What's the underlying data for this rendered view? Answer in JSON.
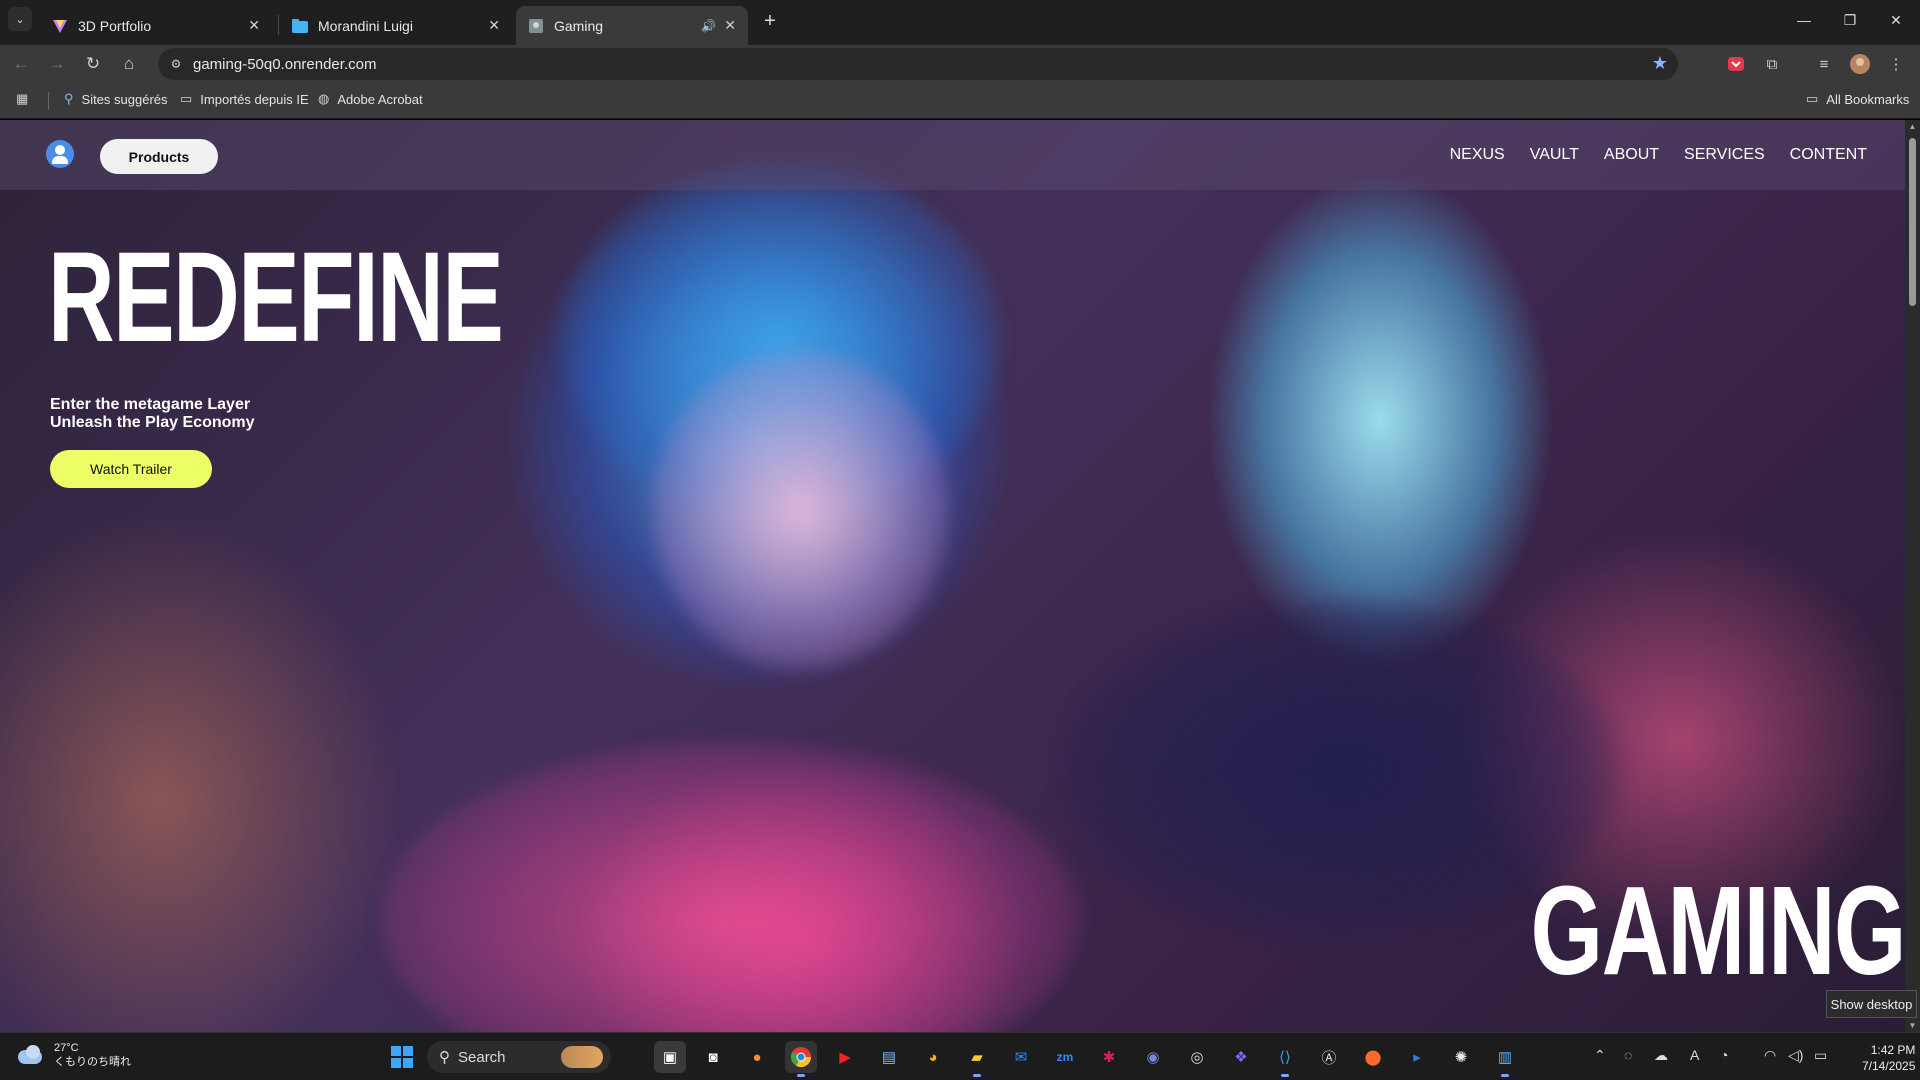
{
  "browser": {
    "tabs": [
      {
        "title": "3D Portfolio",
        "active": false
      },
      {
        "title": "Morandini Luigi",
        "active": false
      },
      {
        "title": "Gaming",
        "active": true
      }
    ],
    "url": "gaming-50q0.onrender.com",
    "bookmarks": [
      "Sites suggérés",
      "Importés depuis IE",
      "Adobe Acrobat"
    ],
    "all_bookmarks": "All Bookmarks"
  },
  "site": {
    "products_label": "Products",
    "nav": [
      "NEXUS",
      "VAULT",
      "ABOUT",
      "SERVICES",
      "CONTENT"
    ],
    "hero_title": "REDEFINE",
    "subtitle_line1": "Enter the metagame Layer",
    "subtitle_line2": "Unleash the Play Economy",
    "cta_label": "Watch Trailer",
    "hero_bottom": "GAMING"
  },
  "tooltip": "Show desktop",
  "taskbar": {
    "weather_temp": "27°C",
    "weather_desc": "くもりのち晴れ",
    "search_label": "Search",
    "time": "1:42 PM",
    "date": "7/14/2025"
  },
  "colors": {
    "cta": "#edff66",
    "accent_blue": "#8ab4f8"
  }
}
